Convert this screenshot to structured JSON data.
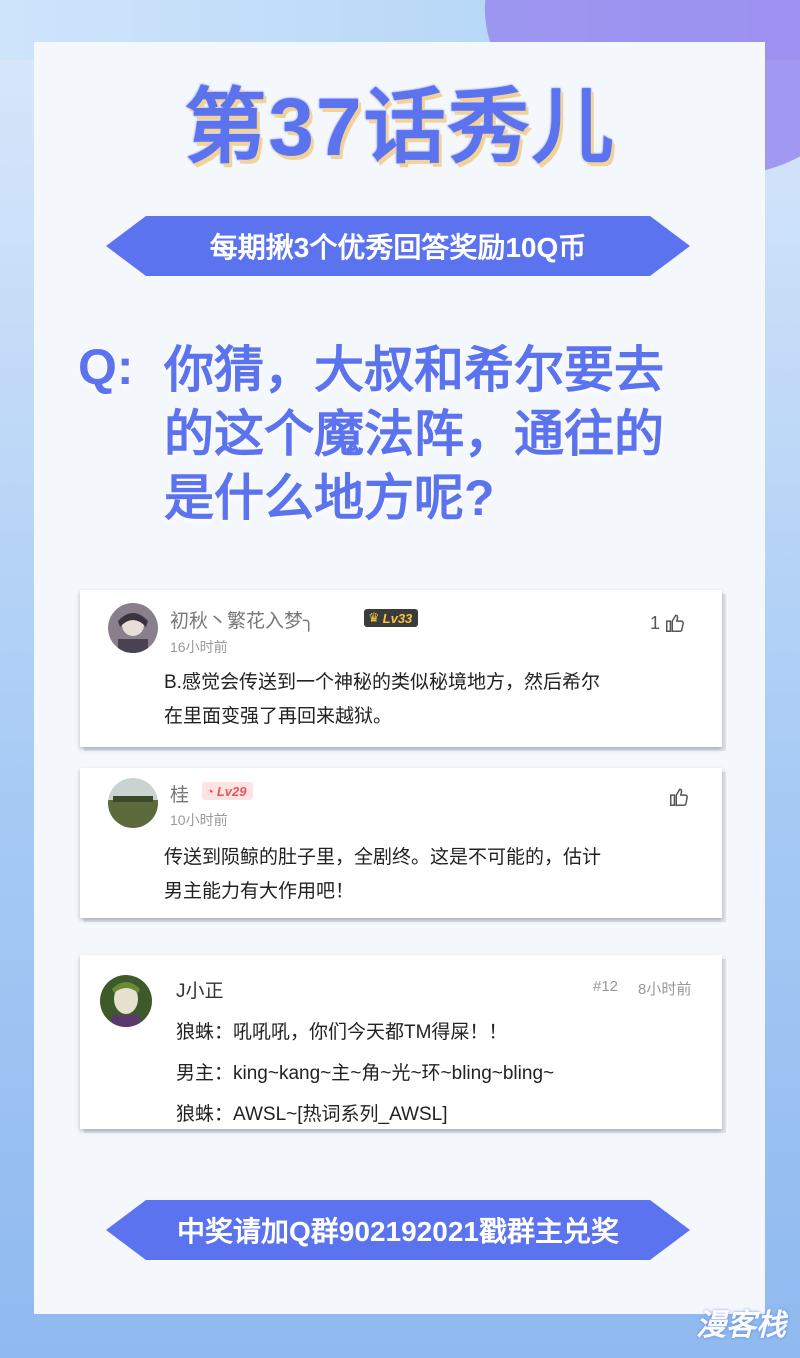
{
  "title": "第37话秀儿",
  "banner_top": "每期揪3个优秀回答奖励10Q币",
  "question": {
    "prefix": "Q:",
    "lines": [
      "你猜，大叔和希尔要去",
      "的这个魔法阵，通往的",
      "是什么地方呢?"
    ]
  },
  "comments": [
    {
      "username": "初秋丶繁花入梦╮",
      "level": "Lv33",
      "time": "16小时前",
      "likes": "1",
      "lines": [
        "B.感觉会传送到一个神秘的类似秘境地方，然后希尔",
        "在里面变强了再回来越狱。"
      ]
    },
    {
      "username": "桂",
      "level": "Lv29",
      "time": "10小时前",
      "likes": "",
      "lines": [
        "传送到陨鲸的肚子里，全剧终。这是不可能的，估计",
        "男主能力有大作用吧！"
      ]
    },
    {
      "username": "J小正",
      "floor": "#12",
      "time": "8小时前",
      "lines": [
        "狼蛛：吼吼吼，你们今天都TM得屎！！",
        "男主：king~kang~主~角~光~环~bling~bling~",
        "狼蛛：AWSL~[热词系列_AWSL]"
      ]
    }
  ],
  "banner_bottom": "中奖请加Q群902192021戳群主兑奖",
  "watermark": "漫客栈",
  "colors": {
    "accent": "#5b73ee",
    "title_shadow": "#f3d29a"
  }
}
